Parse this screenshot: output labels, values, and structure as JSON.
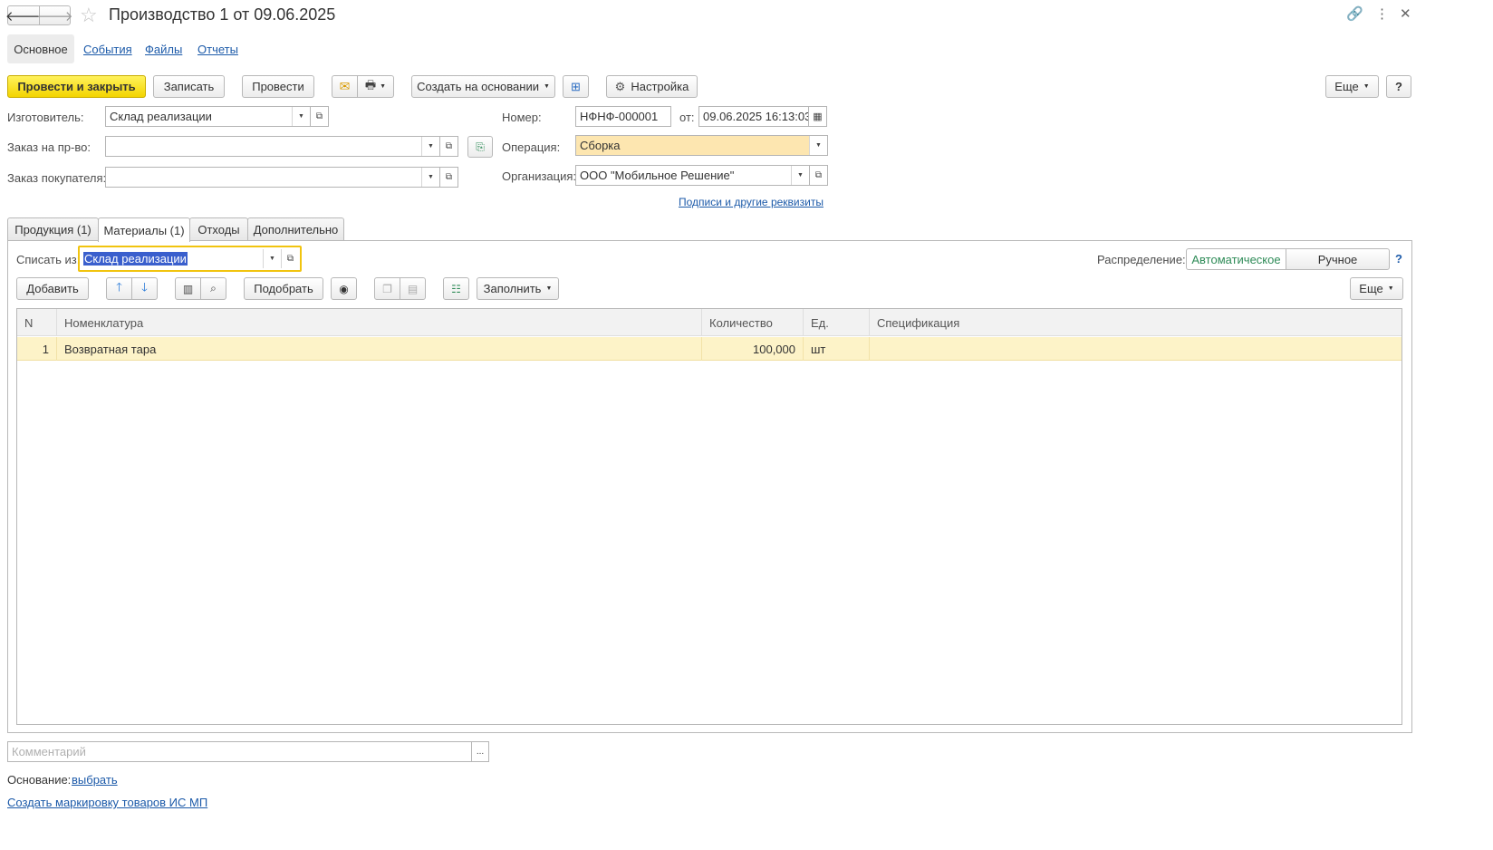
{
  "window": {
    "title": "Производство 1 от 09.06.2025"
  },
  "nav_tabs": [
    {
      "label": "Основное"
    },
    {
      "label": "События"
    },
    {
      "label": "Файлы"
    },
    {
      "label": "Отчеты"
    }
  ],
  "toolbar": {
    "post_close": "Провести и закрыть",
    "save": "Записать",
    "post": "Провести",
    "create_based": "Создать на основании",
    "settings": "Настройка",
    "more": "Еще",
    "help": "?"
  },
  "form": {
    "manufacturer_label": "Изготовитель:",
    "manufacturer_value": "Склад реализации",
    "prod_order_label": "Заказ на пр-во:",
    "prod_order_value": "",
    "customer_order_label": "Заказ покупателя:",
    "customer_order_value": "",
    "number_label": "Номер:",
    "number_value": "НФНФ-000001",
    "date_label": "от:",
    "date_value": "09.06.2025 16:13:03",
    "operation_label": "Операция:",
    "operation_value": "Сборка",
    "org_label": "Организация:",
    "org_value": "ООО \"Мобильное Решение\"",
    "signatures_link": "Подписи и другие реквизиты"
  },
  "content_tabs": [
    {
      "label": "Продукция (1)"
    },
    {
      "label": "Материалы (1)"
    },
    {
      "label": "Отходы"
    },
    {
      "label": "Дополнительно"
    }
  ],
  "materials": {
    "writeoff_label": "Списать из:",
    "writeoff_value": "Склад реализации",
    "distribution_label": "Распределение:",
    "distribution_auto": "Автоматическое",
    "distribution_manual": "Ручное",
    "help": "?",
    "add": "Добавить",
    "pick": "Подобрать",
    "fill": "Заполнить",
    "more": "Еще",
    "columns": {
      "n": "N",
      "nomenclature": "Номенклатура",
      "quantity": "Количество",
      "unit": "Ед.",
      "spec": "Спецификация"
    },
    "rows": [
      {
        "n": "1",
        "nomenclature": "Возвратная тара",
        "quantity": "100,000",
        "unit": "шт",
        "spec": ""
      }
    ]
  },
  "footer": {
    "comment_placeholder": "Комментарий",
    "basis_label": "Основание:",
    "basis_link": "выбрать",
    "marking_link": "Создать маркировку товаров ИС МП"
  },
  "colors": {
    "primary_button": "#f3d400",
    "selected_row": "#fdf3c8",
    "operation_field": "#fde6b0",
    "active_field_border": "#f1c40f",
    "auto_toggle_text": "#2e8b57",
    "link": "#1c5aa9"
  }
}
